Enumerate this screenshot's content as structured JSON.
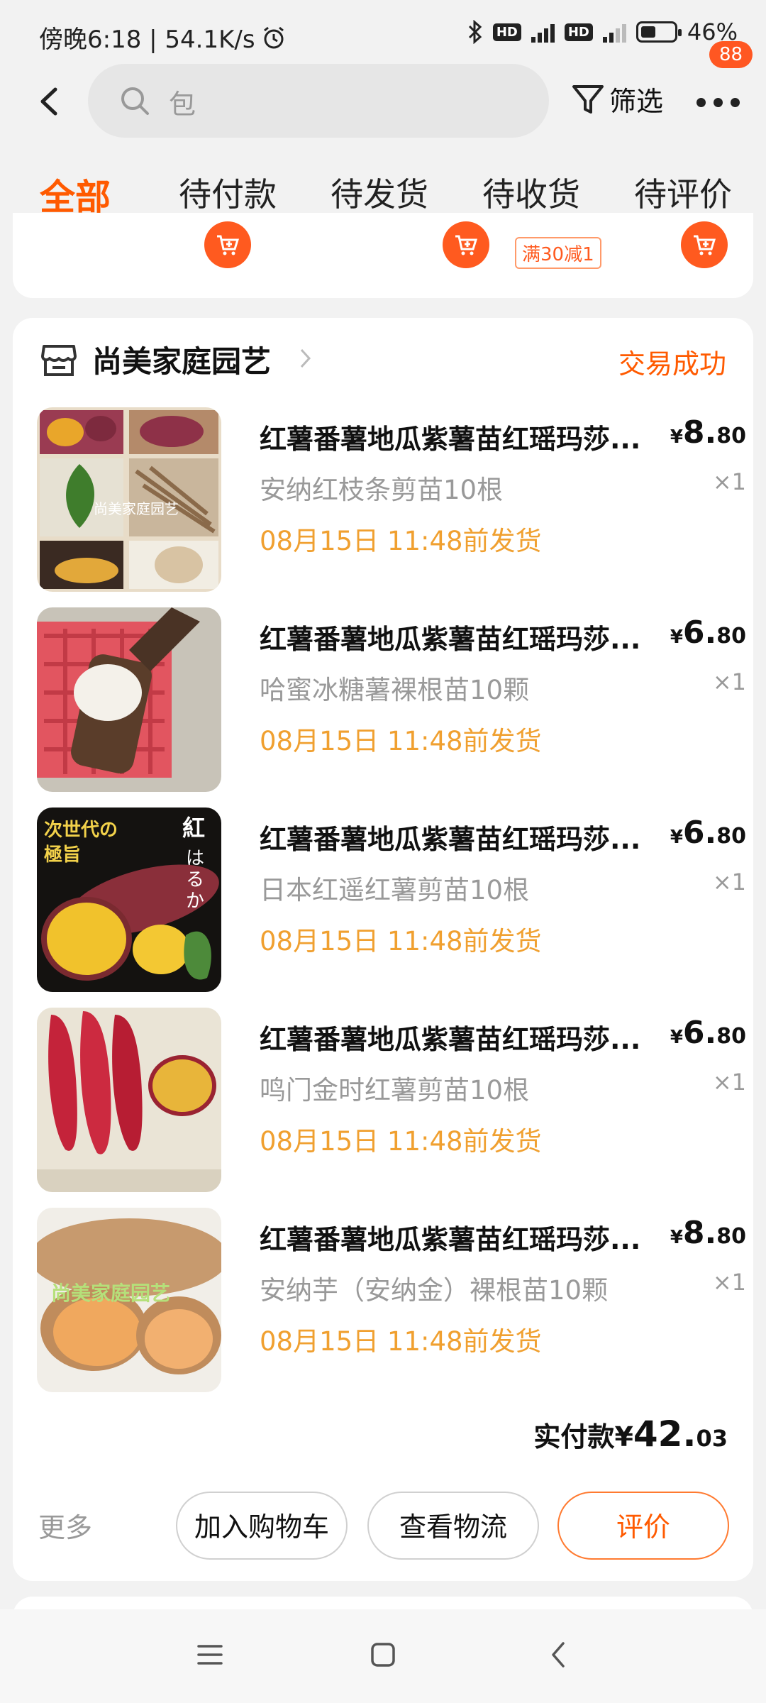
{
  "status_bar": {
    "time": "傍晚6:18 | 54.1K/s",
    "network_hd": "HD",
    "network_4g": "4G",
    "battery_percent": "46%",
    "battery_level": 0.46
  },
  "header": {
    "search_value": "包",
    "filter_label": "筛选",
    "more_badge": "88"
  },
  "tabs": [
    {
      "label": "全部",
      "active": true
    },
    {
      "label": "待付款",
      "active": false
    },
    {
      "label": "待发货",
      "active": false
    },
    {
      "label": "待收货",
      "active": false
    },
    {
      "label": "待评价",
      "active": false
    }
  ],
  "prev_card": {
    "promo": "满30减1"
  },
  "order": {
    "shop_name": "尚美家庭园艺",
    "status": "交易成功",
    "items": [
      {
        "title": "红薯番薯地瓜紫薯苗红瑶玛莎...",
        "spec": "安纳红枝条剪苗10根",
        "ship": "08月15日 11:48前发货",
        "price_int": "8.",
        "price_cents": "80",
        "qty": "×1"
      },
      {
        "title": "红薯番薯地瓜紫薯苗红瑶玛莎...",
        "spec": "哈蜜冰糖薯裸根苗10颗",
        "ship": "08月15日 11:48前发货",
        "price_int": "6.",
        "price_cents": "80",
        "qty": "×1"
      },
      {
        "title": "红薯番薯地瓜紫薯苗红瑶玛莎...",
        "spec": "日本红遥红薯剪苗10根",
        "ship": "08月15日 11:48前发货",
        "price_int": "6.",
        "price_cents": "80",
        "qty": "×1"
      },
      {
        "title": "红薯番薯地瓜紫薯苗红瑶玛莎...",
        "spec": "鸣门金时红薯剪苗10根",
        "ship": "08月15日 11:48前发货",
        "price_int": "6.",
        "price_cents": "80",
        "qty": "×1"
      },
      {
        "title": "红薯番薯地瓜紫薯苗红瑶玛莎...",
        "spec": "安纳芋（安纳金）裸根苗10颗",
        "ship": "08月15日 11:48前发货",
        "price_int": "8.",
        "price_cents": "80",
        "qty": "×1"
      }
    ],
    "total_label": "实付款",
    "currency": "¥",
    "total_int": "42.",
    "total_cents": "03",
    "more_label": "更多",
    "buttons": {
      "add_cart": "加入购物车",
      "logistics": "查看物流",
      "review": "评价"
    }
  },
  "colors": {
    "accent": "#ff5a00",
    "ship_date": "#f0a030"
  }
}
